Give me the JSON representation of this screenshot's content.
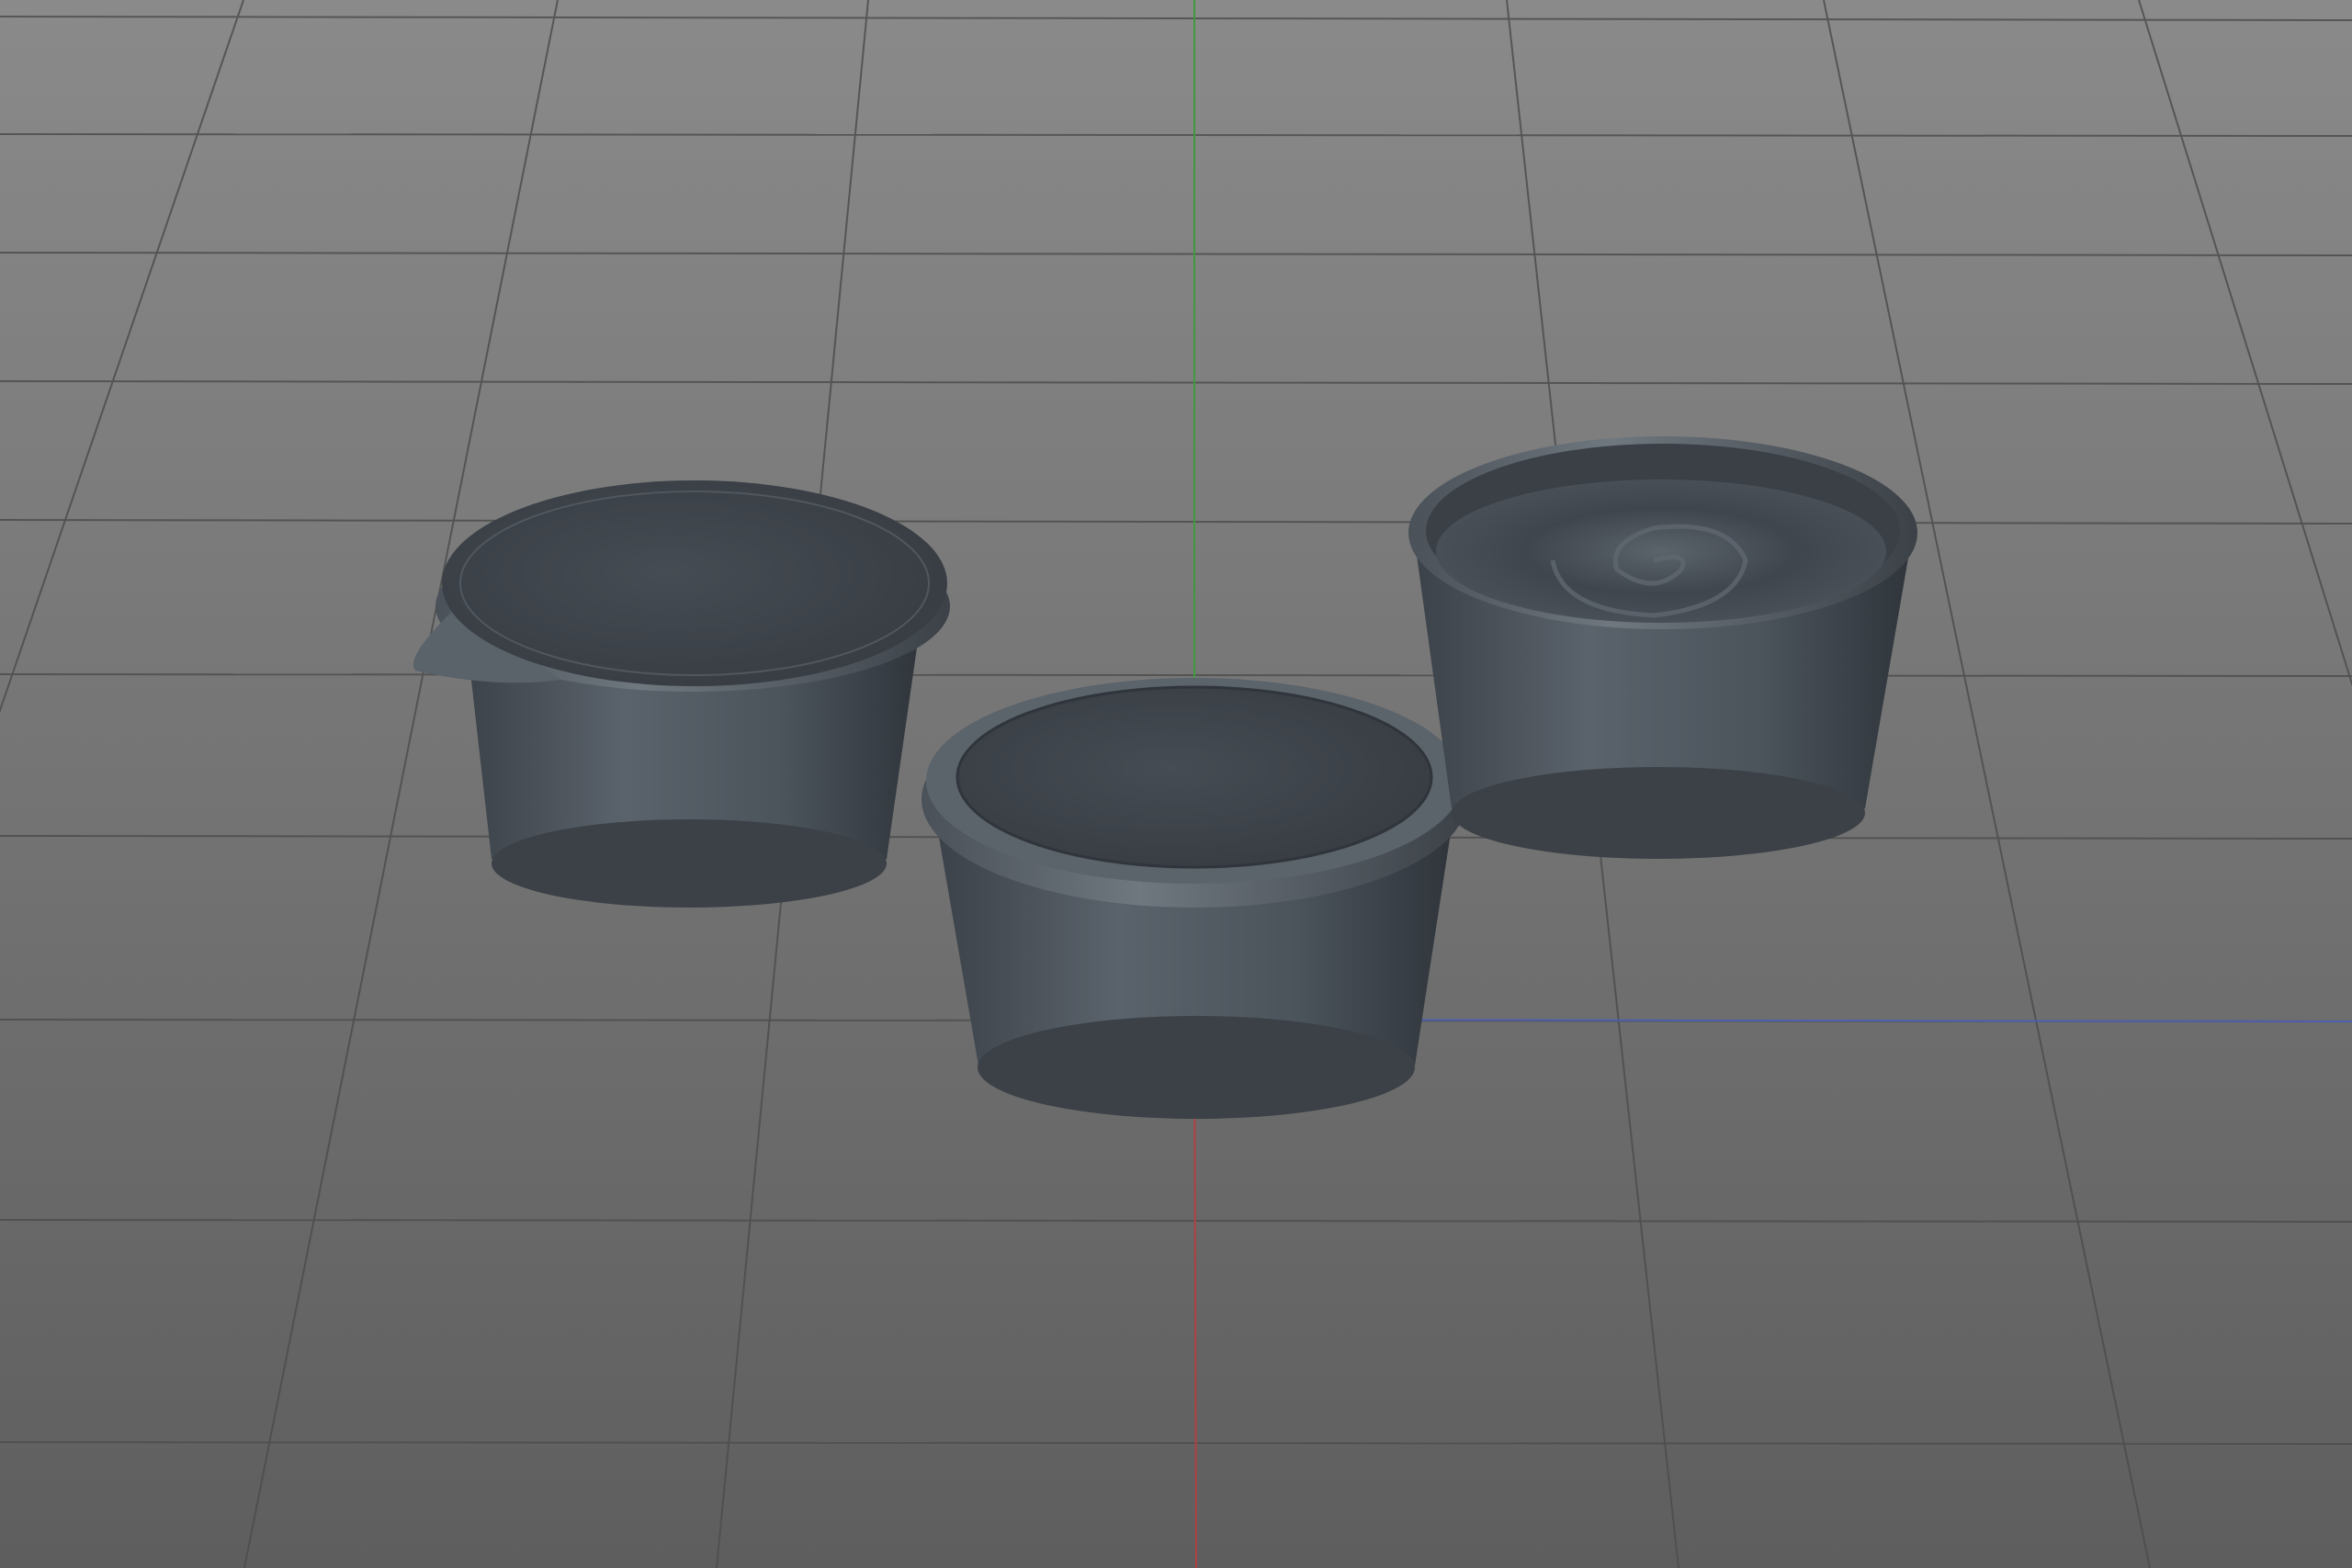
{
  "viewport": {
    "name": "3d-viewport",
    "background_top": "#888888",
    "background_bottom": "#5f5f5f",
    "grid_color": "#4e4e4e",
    "grid_visible": true,
    "axes": {
      "y_axis_color": "#3f9a3f",
      "x_axis_color": "#b04040",
      "z_axis_color": "#4e5fb0"
    }
  },
  "objects": [
    {
      "name": "cup-with-tab-lid",
      "description_type": "container with sealed lid and pull tab",
      "body_color": "#4d545c",
      "lid_color": "#3e444b"
    },
    {
      "name": "cup-with-recessed-lid",
      "description_type": "container with rimmed lid",
      "body_color": "#4d545c",
      "lid_color": "#3c4249"
    },
    {
      "name": "cup-with-swirl-top",
      "description_type": "open container with swirl content",
      "body_color": "#4d545c",
      "lid_color": "#454c54"
    }
  ]
}
